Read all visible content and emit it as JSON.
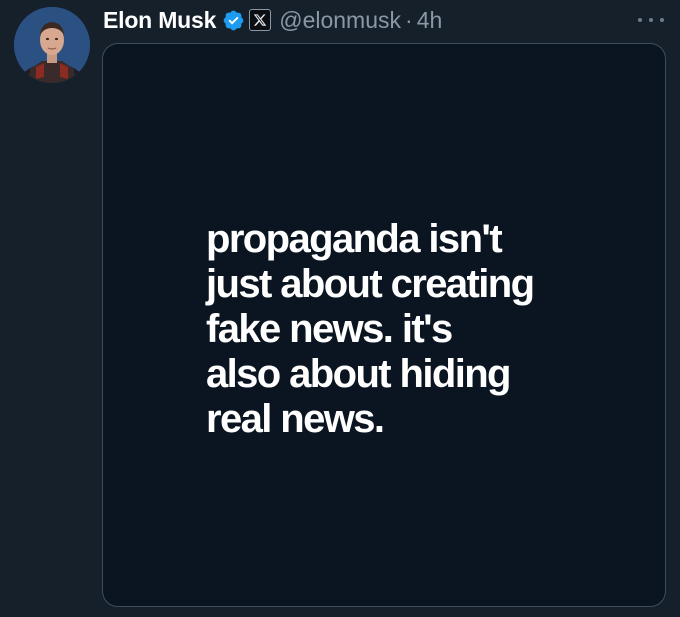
{
  "author": {
    "name": "Elon Musk",
    "handle": "@elonmusk",
    "separator": "·",
    "time": "4h",
    "avatar_icon": "profile-photo",
    "verified_icon": "verified-badge-icon",
    "affiliation_icon": "x-logo-icon"
  },
  "post": {
    "image_text_lines": [
      "propaganda isn't",
      "just about creating",
      "fake news. it's",
      "also about hiding",
      "real news."
    ]
  },
  "colors": {
    "background": "#15202b",
    "card": "#0b1521",
    "verified": "#1d9bf0",
    "muted": "#8b98a5"
  }
}
